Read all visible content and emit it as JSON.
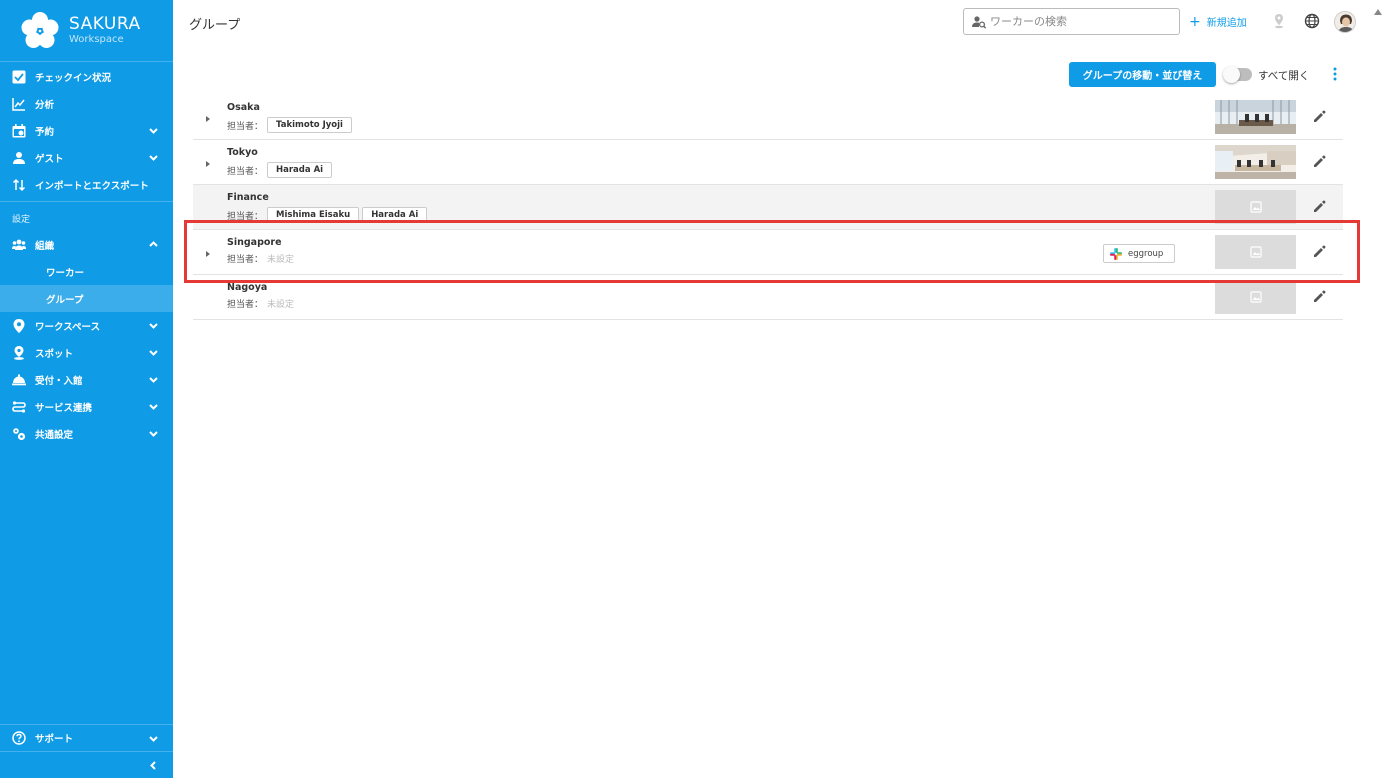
{
  "app": {
    "brand_name": "SAKURA",
    "brand_sub": "Workspace"
  },
  "sidebar": {
    "items": [
      {
        "label": "チェックイン状況",
        "icon": "checkbox-icon"
      },
      {
        "label": "分析",
        "icon": "analytics-icon"
      },
      {
        "label": "予約",
        "icon": "calendar-icon"
      },
      {
        "label": "ゲスト",
        "icon": "guest-icon"
      },
      {
        "label": "インポートとエクスポート",
        "icon": "import-export-icon"
      }
    ],
    "section_label": "設定",
    "settings_items": [
      {
        "label": "組織",
        "icon": "organization-icon"
      },
      {
        "label": "ワークスペース",
        "icon": "location-pin-icon"
      },
      {
        "label": "スポット",
        "icon": "spot-pin-icon"
      },
      {
        "label": "受付・入館",
        "icon": "reception-icon"
      },
      {
        "label": "サービス連携",
        "icon": "service-link-icon"
      },
      {
        "label": "共通設定",
        "icon": "settings-gears-icon"
      }
    ],
    "org_sub_items": [
      "ワーカー",
      "グループ"
    ],
    "support_label": "サポート"
  },
  "header": {
    "title": "グループ",
    "search_placeholder": "ワーカーの検索",
    "new_button": "新規追加"
  },
  "toolbar": {
    "move_button": "グループの移動・並び替え",
    "expand_all_label": "すべて開く",
    "expand_all_on": false
  },
  "groups": {
    "manager_label": "担当者：",
    "unset_label": "未設定",
    "rows": [
      {
        "name": "Osaka",
        "managers": [
          "Takimoto Jyoji"
        ],
        "has_children": true,
        "has_photo": true
      },
      {
        "name": "Tokyo",
        "managers": [
          "Harada Ai"
        ],
        "has_children": true,
        "has_photo": true
      },
      {
        "name": "Finance",
        "managers": [
          "Mishima Eisaku",
          "Harada Ai"
        ],
        "has_children": false,
        "has_photo": false
      },
      {
        "name": "Singapore",
        "managers": [],
        "has_children": true,
        "has_photo": false,
        "integration": "eggroup"
      },
      {
        "name": "Nagoya",
        "managers": [],
        "has_children": false,
        "has_photo": false
      }
    ]
  },
  "colors": {
    "brand_blue": "#0f9be6",
    "highlight_red": "#e53935"
  }
}
